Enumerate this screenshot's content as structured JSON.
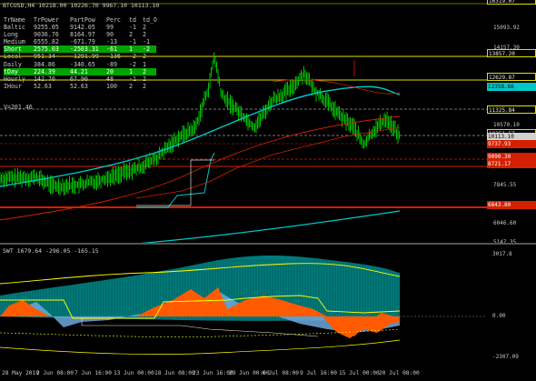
{
  "main": {
    "title": "BTCUSD,H4  10218.00 10226.70 9967.10 10113.10",
    "table_header": [
      "TrName",
      "TrPower",
      "PartPow",
      "Perc",
      "td",
      "td_O"
    ],
    "table_rows": [
      [
        "Baltic",
        "9255.05",
        "9142.05",
        "99",
        "-1",
        "2"
      ],
      [
        "Long",
        "9036.76",
        "8164.97",
        "90",
        "2",
        "2"
      ],
      [
        "Medium",
        "6555.82",
        "-671.79",
        "-13",
        "-1",
        "-1"
      ],
      [
        "Short",
        "2575.03",
        "-2503.31",
        "-61",
        "1",
        "-2"
      ],
      [
        "Local",
        "951.34",
        "-1291.99",
        "-136",
        "-2",
        "2"
      ],
      [
        "Daily",
        "384.86",
        "-340.65",
        "-89",
        "-2",
        "1"
      ],
      [
        "tDay",
        "224.39",
        "44.21",
        "20",
        "1",
        "2"
      ],
      [
        "Hourly",
        "142.70",
        "67.90",
        "48",
        "-1",
        "2"
      ],
      [
        "IHour",
        "52.63",
        "52.63",
        "100",
        "2",
        "2"
      ]
    ],
    "highlight_rows": [
      3,
      6
    ],
    "v_label": "V=201.46",
    "price_axis": [
      {
        "text": "16319.07",
        "style": "box"
      },
      {
        "text": "15093.92",
        "style": "plain"
      },
      {
        "text": "14157.30",
        "style": "plain"
      },
      {
        "text": "13857.20",
        "style": "box"
      },
      {
        "text": "12629.87",
        "style": "box"
      },
      {
        "text": "12358.66",
        "style": "boxteal"
      },
      {
        "text": "11325.84",
        "style": "box"
      },
      {
        "text": "10570.10",
        "style": "plain"
      },
      {
        "text": "10251.57",
        "style": "box"
      },
      {
        "text": "10113.10",
        "style": "boxgrey"
      },
      {
        "text": "9737.93",
        "style": "boxred"
      },
      {
        "text": "9090.30",
        "style": "boxred"
      },
      {
        "text": "8721.17",
        "style": "boxred"
      },
      {
        "text": "7845.55",
        "style": "plain"
      },
      {
        "text": "6843.80",
        "style": "boxred"
      },
      {
        "text": "6046.60",
        "style": "plain"
      },
      {
        "text": "5147.35",
        "style": "plain"
      }
    ]
  },
  "osc": {
    "title": "SWT 1679.64 -296.05 -165.15",
    "axis": [
      "3017.8",
      "0.00",
      "-2307.09"
    ]
  },
  "dates": [
    "28 May 2019",
    "2 Jun 08:00",
    "7 Jun 16:00",
    "13 Jun 00:00",
    "18 Jun 08:00",
    "23 Jun 16:00",
    "29 Jun 00:00",
    "4 Jul 08:00",
    "9 Jul 16:00",
    "15 Jul 00:00",
    "20 Jul 08:00"
  ],
  "colors": {
    "price": "#00c000",
    "ma_teal": "#00c8c8",
    "ma_red": "#d02000",
    "level_yellow": "#ffff00",
    "osc_orange": "#ff5a00",
    "osc_blue": "#6fa8dc",
    "osc_teal": "#009090"
  }
}
